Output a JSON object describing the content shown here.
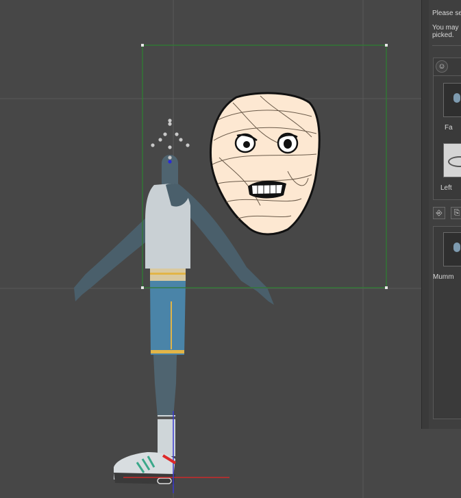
{
  "panel": {
    "line1": "Please se",
    "line2a": "You may i",
    "line2b": "picked.",
    "thumb1_label": "Fa",
    "thumb2_label": "Left",
    "thumb3_label": "Mumm"
  },
  "icons": {
    "face_tool": "face-icon",
    "import": "import-icon",
    "export": "export-icon"
  }
}
